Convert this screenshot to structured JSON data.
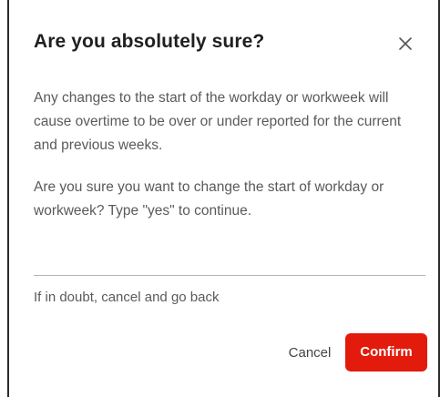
{
  "dialog": {
    "title": "Are you absolutely sure?",
    "close_icon": "close-icon",
    "paragraph_1": "Any changes to the start of the workday or workweek will cause overtime to be over or under reported for the current and previous weeks.",
    "paragraph_2": "Are you sure you want to change the start of workday or workweek? Type \"yes\" to continue.",
    "input_value": "",
    "helper_text": "If in doubt, cancel and go back",
    "cancel_label": "Cancel",
    "confirm_label": "Confirm"
  },
  "colors": {
    "confirm_bg": "#e21b0c",
    "text_primary": "#1f1f1f",
    "text_secondary": "#5a5a5a",
    "input_underline": "#b5b5b5"
  }
}
